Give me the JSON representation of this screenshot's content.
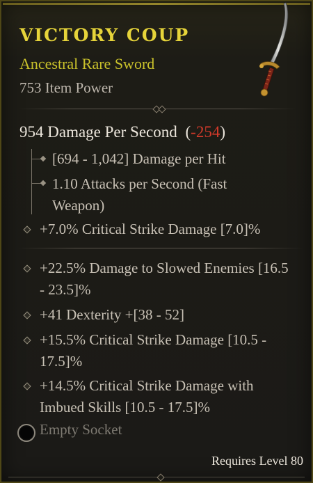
{
  "item": {
    "name": "Victory Coup",
    "type": "Ancestral Rare Sword",
    "item_power": "753 Item Power"
  },
  "dps": {
    "label": "954 Damage Per Second",
    "open": "(",
    "delta": "-254",
    "close": ")"
  },
  "base_stats": [
    "[694 - 1,042] Damage per Hit",
    "1.10 Attacks per Second (Fast Weapon)"
  ],
  "implicit": "+7.0% Critical Strike Damage [7.0]%",
  "affixes": [
    "+22.5% Damage to Slowed Enemies [16.5 - 23.5]%",
    "+41 Dexterity +[38 - 52]",
    "+15.5% Critical Strike Damage [10.5 - 17.5]%",
    "+14.5% Critical Strike Damage with Imbued Skills [10.5 - 17.5]%"
  ],
  "socket": "Empty Socket",
  "requirement": "Requires Level 80",
  "colors": {
    "rare_title": "#e6d43a",
    "rare_subtitle": "#c9c12b",
    "negative": "#d23a2a",
    "border": "#4f4717"
  },
  "icons": [
    "sword-icon",
    "socket-icon"
  ]
}
